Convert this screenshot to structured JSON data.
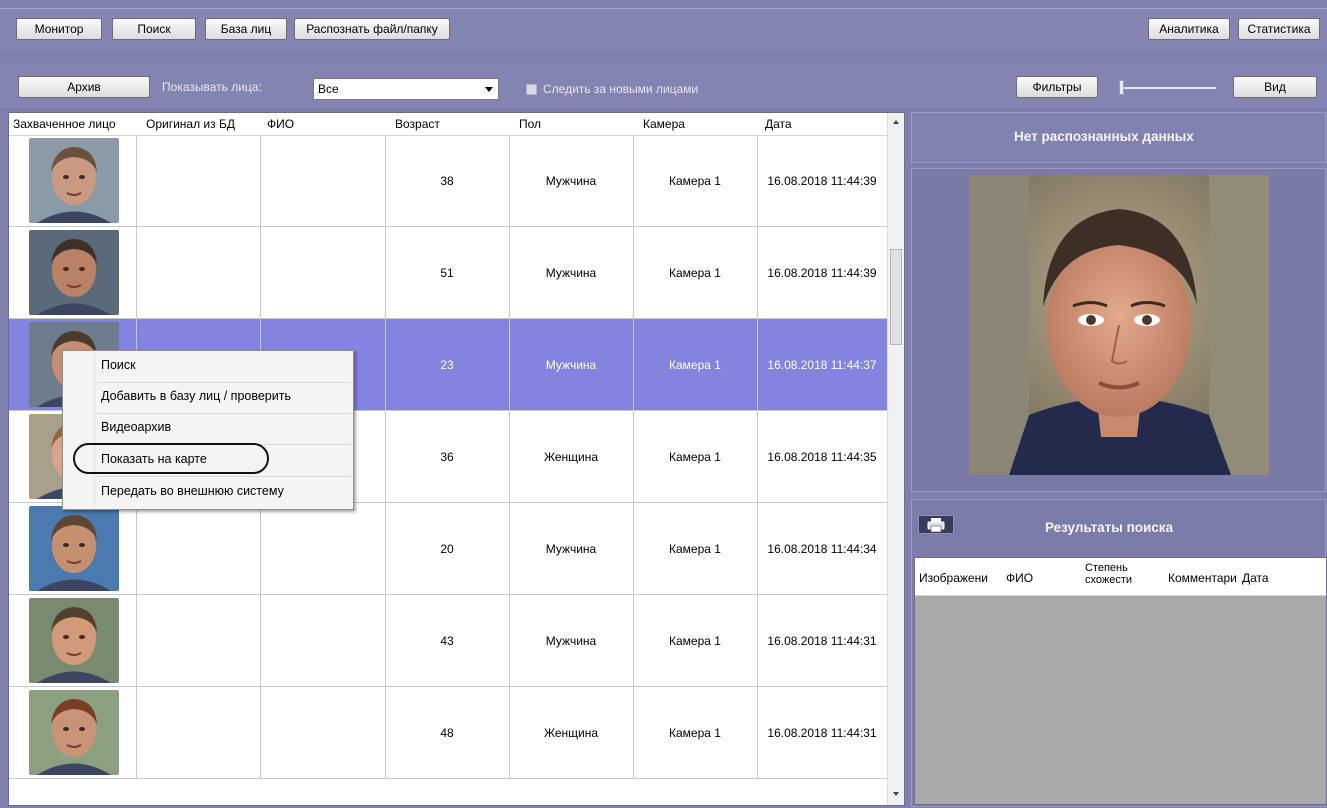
{
  "toolbar": {
    "monitor_label": "Монитор",
    "search_label": "Поиск",
    "face_db_label": "База лиц",
    "recognize_label": "Распознать файл/папку",
    "analytics_label": "Аналитика",
    "statistics_label": "Статистика"
  },
  "filterbar": {
    "archive_label": "Архив",
    "show_faces_label": "Показывать лица:",
    "show_faces_value": "Все",
    "follow_new_label": "Следить за новыми лицами",
    "follow_new_checked": false,
    "filters_label": "Фильтры",
    "view_label": "Вид",
    "slider_level": 0
  },
  "table": {
    "headers": [
      "Захваченное лицо",
      "Оригинал из БД",
      "ФИО",
      "Возраст",
      "Пол",
      "Камера",
      "Дата"
    ],
    "rows": [
      {
        "age": "38",
        "gender": "Мужчина",
        "camera": "Камера 1",
        "date": "16.08.2018 11:44:39",
        "selected": false
      },
      {
        "age": "51",
        "gender": "Мужчина",
        "camera": "Камера 1",
        "date": "16.08.2018 11:44:39",
        "selected": false
      },
      {
        "age": "23",
        "gender": "Мужчина",
        "camera": "Камера 1",
        "date": "16.08.2018 11:44:37",
        "selected": true
      },
      {
        "age": "36",
        "gender": "Женщина",
        "camera": "Камера 1",
        "date": "16.08.2018 11:44:35",
        "selected": false
      },
      {
        "age": "20",
        "gender": "Мужчина",
        "camera": "Камера 1",
        "date": "16.08.2018 11:44:34",
        "selected": false
      },
      {
        "age": "43",
        "gender": "Мужчина",
        "camera": "Камера 1",
        "date": "16.08.2018 11:44:31",
        "selected": false
      },
      {
        "age": "48",
        "gender": "Женщина",
        "camera": "Камера 1",
        "date": "16.08.2018 11:44:31",
        "selected": false
      }
    ]
  },
  "context_menu": {
    "items": [
      "Поиск",
      "Добавить в базу лиц / проверить",
      "Видеоархив",
      "Показать на карте",
      "Передать во внешнюю систему"
    ],
    "highlighted": "Показать на карте"
  },
  "recognition": {
    "title": "Нет распознанных данных"
  },
  "search_results": {
    "title": "Результаты поиска",
    "headers": [
      "Изображени",
      "ФИО",
      "Степень схожести",
      "Комментари",
      "Дата"
    ],
    "header_lines_similarity": [
      "Степень",
      "схожести"
    ]
  },
  "colors": {
    "app_bg": "#7f7fad",
    "toolbar_bg": "#8585b3",
    "selected_row": "#8383e0",
    "results_bg": "#a9a9a9"
  }
}
